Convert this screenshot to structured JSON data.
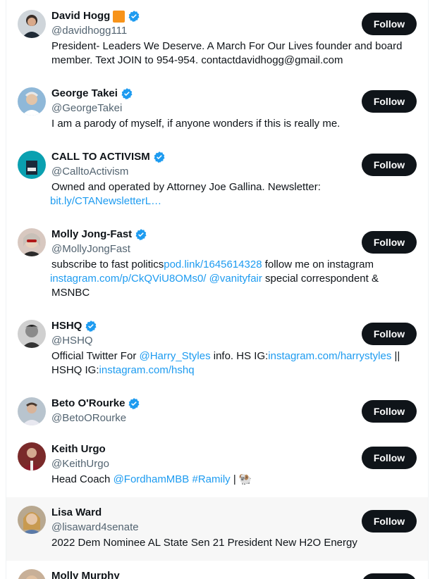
{
  "colors": {
    "link": "#1d9bf0",
    "verified": "#1d9bf0",
    "button_bg": "#0f1419",
    "handle": "#536471",
    "hover_bg": "#f7f7f7",
    "orange_badge": "#f7931a"
  },
  "follow_label": "Follow",
  "accounts": [
    {
      "name": "David Hogg",
      "handle": "@davidhogg111",
      "verified": true,
      "extra_badge": "orange-square",
      "bio": [
        "President- Leaders We Deserve. A March For Our Lives founder and board",
        "member. Text JOIN to 954-954. contactdavidhogg@gmail.com"
      ]
    },
    {
      "name": "George Takei",
      "handle": "@GeorgeTakei",
      "verified": true,
      "bio": [
        "I am a parody of myself, if anyone wonders if this is really me."
      ]
    },
    {
      "name": "CALL TO ACTIVISM",
      "handle": "@CalltoActivism",
      "verified": true,
      "bio_text": "Owned and operated by Attorney Joe Gallina. Newsletter:",
      "bio_link": "bit.ly/CTANewsletterL…"
    },
    {
      "name": "Molly Jong-Fast",
      "handle": "@MollyJongFast",
      "verified": true,
      "bio_parts": {
        "t1": "subscribe to fast politics",
        "l1": "pod.link/1645614328",
        "t2": " follow me on instagram",
        "l2": "instagram.com/p/CkQViU8OMs0/",
        "t3": " ",
        "l3": "@vanityfair",
        "t4": " special correspondent &",
        "t5": "MSNBC"
      }
    },
    {
      "name": "HSHQ",
      "handle": "@HSHQ",
      "verified": true,
      "bio_parts": {
        "t1": "Official Twitter For ",
        "l1": "@Harry_Styles",
        "t2": " info. HS IG:",
        "l2": "instagram.com/harrystyles",
        "t3": " ||",
        "t4": "HSHQ IG:",
        "l3": "instagram.com/hshq"
      }
    },
    {
      "name": "Beto O'Rourke",
      "handle": "@BetoORourke",
      "verified": true
    },
    {
      "name": "Keith Urgo",
      "handle": "@KeithUrgo",
      "verified": false,
      "bio_parts": {
        "t1": "Head Coach ",
        "l1": "@FordhamMBB",
        "t2": " ",
        "l2": "#Ramily",
        "t3": " | ",
        "emoji": "🐏"
      }
    },
    {
      "name": "Lisa Ward",
      "handle": "@lisaward4senate",
      "verified": false,
      "bio": [
        "2022 Dem Nominee AL State Sen 21 President New H2O Energy"
      ]
    },
    {
      "name": "Molly Murphy",
      "verified": false
    }
  ]
}
